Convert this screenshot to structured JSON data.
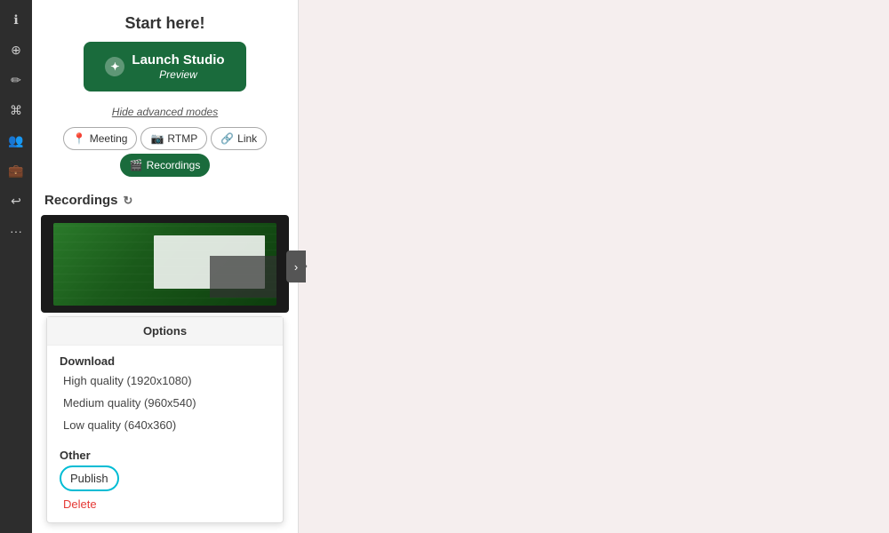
{
  "sidebar": {
    "icons": [
      {
        "name": "info-icon",
        "symbol": "ℹ"
      },
      {
        "name": "share-icon",
        "symbol": "⊕"
      },
      {
        "name": "edit-icon",
        "symbol": "✏"
      },
      {
        "name": "fingerprint-icon",
        "symbol": "⌘"
      },
      {
        "name": "group-icon",
        "symbol": "👥"
      },
      {
        "name": "briefcase-icon",
        "symbol": "💼"
      },
      {
        "name": "forward-icon",
        "symbol": "↩"
      },
      {
        "name": "more-icon",
        "symbol": "•••"
      }
    ]
  },
  "panel": {
    "start_here": "Start here!",
    "launch_btn_line1": "Launch Studio",
    "launch_btn_line2": "Preview",
    "hide_advanced": "Hide advanced modes",
    "mode_buttons": [
      {
        "label": "Meeting",
        "active": false
      },
      {
        "label": "RTMP",
        "active": false
      },
      {
        "label": "Link",
        "active": false
      },
      {
        "label": "Recordings",
        "active": true
      }
    ],
    "recordings_title": "Recordings",
    "options": {
      "header": "Options",
      "download_label": "Download",
      "items": [
        {
          "label": "High quality (1920x1080)"
        },
        {
          "label": "Medium quality (960x540)"
        },
        {
          "label": "Low quality (640x360)"
        }
      ],
      "other_label": "Other",
      "publish_label": "Publish",
      "delete_label": "Delete"
    }
  },
  "colors": {
    "green": "#1a6b3c",
    "delete_red": "#e53935",
    "publish_border": "#00bcd4"
  }
}
